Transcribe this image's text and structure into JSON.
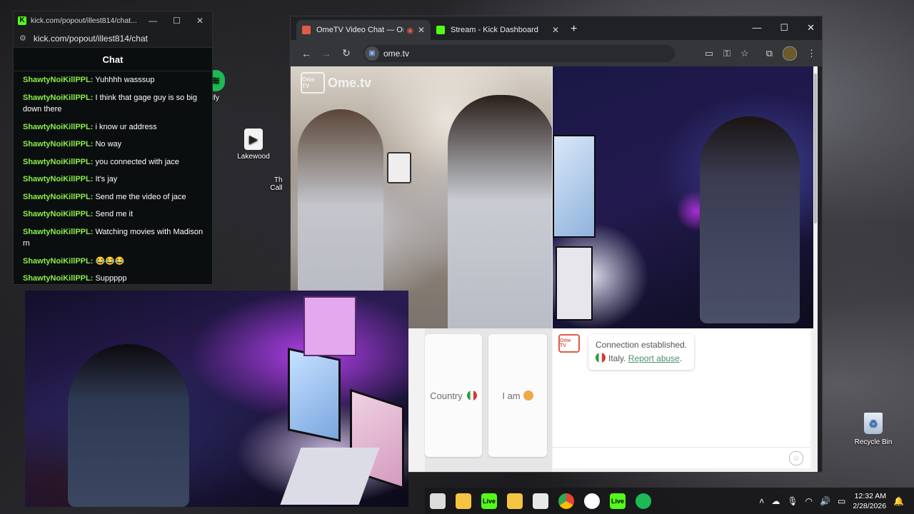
{
  "kick_window": {
    "title": "kick.com/popout/illest814/chat...",
    "url": "kick.com/popout/illest814/chat",
    "chat_header": "Chat",
    "messages": [
      {
        "user": "ShawtyNoiKillPPL:",
        "text": " Yuhhhh wasssup"
      },
      {
        "user": "ShawtyNoiKillPPL:",
        "text": " I think that gage guy is so big down there"
      },
      {
        "user": "ShawtyNoiKillPPL:",
        "text": " i know ur address"
      },
      {
        "user": "ShawtyNoiKillPPL:",
        "text": " No way"
      },
      {
        "user": "ShawtyNoiKillPPL:",
        "text": " you connected with jace"
      },
      {
        "user": "ShawtyNoiKillPPL:",
        "text": " It's jay"
      },
      {
        "user": "ShawtyNoiKillPPL:",
        "text": " Send me the video of jace"
      },
      {
        "user": "ShawtyNoiKillPPL:",
        "text": " Send me it"
      },
      {
        "user": "ShawtyNoiKillPPL:",
        "text": " Watching movies with Madison rn"
      },
      {
        "user": "ShawtyNoiKillPPL:",
        "text": " 😂😂😂"
      },
      {
        "user": "ShawtyNoiKillPPL:",
        "text": " Suppppp"
      }
    ]
  },
  "desktop": {
    "icons": [
      {
        "label": "ify"
      },
      {
        "label": "Lakewood"
      },
      {
        "label": "Th\nCall"
      }
    ],
    "recycle_bin": "Recycle Bin"
  },
  "browser": {
    "tabs": [
      {
        "label": "OmeTV Video Chat — Ome",
        "color": "#e25b45"
      },
      {
        "label": "Stream - Kick Dashboard",
        "color": "#53fc18"
      }
    ],
    "new_tab": "+",
    "url": "ome.tv"
  },
  "ometv": {
    "watermark": "Ome.tv",
    "watermark_box": "Ome TV",
    "country_label": "Country",
    "iam_label": "I am",
    "system_icon": "Ome TV",
    "connection_text": "Connection established.",
    "country_text": "Italy.",
    "report_link": "Report abuse",
    "report_suffix": ".",
    "input_placeholder": ""
  },
  "taskbar": {
    "apps": [
      {
        "label": "",
        "color": "#dcdcdc"
      },
      {
        "label": "",
        "color": "#f5c542"
      },
      {
        "label": "Live",
        "color": "#53fc18"
      },
      {
        "label": "",
        "color": "#f5c542"
      },
      {
        "label": "",
        "color": "#e8e8e8"
      },
      {
        "label": "",
        "color": "#4285f4"
      },
      {
        "label": "",
        "color": "#ffffff"
      },
      {
        "label": "Live",
        "color": "#53fc18"
      },
      {
        "label": "",
        "color": "#1db954"
      }
    ],
    "time": "12:32 AM",
    "date": "2/28/2026"
  }
}
